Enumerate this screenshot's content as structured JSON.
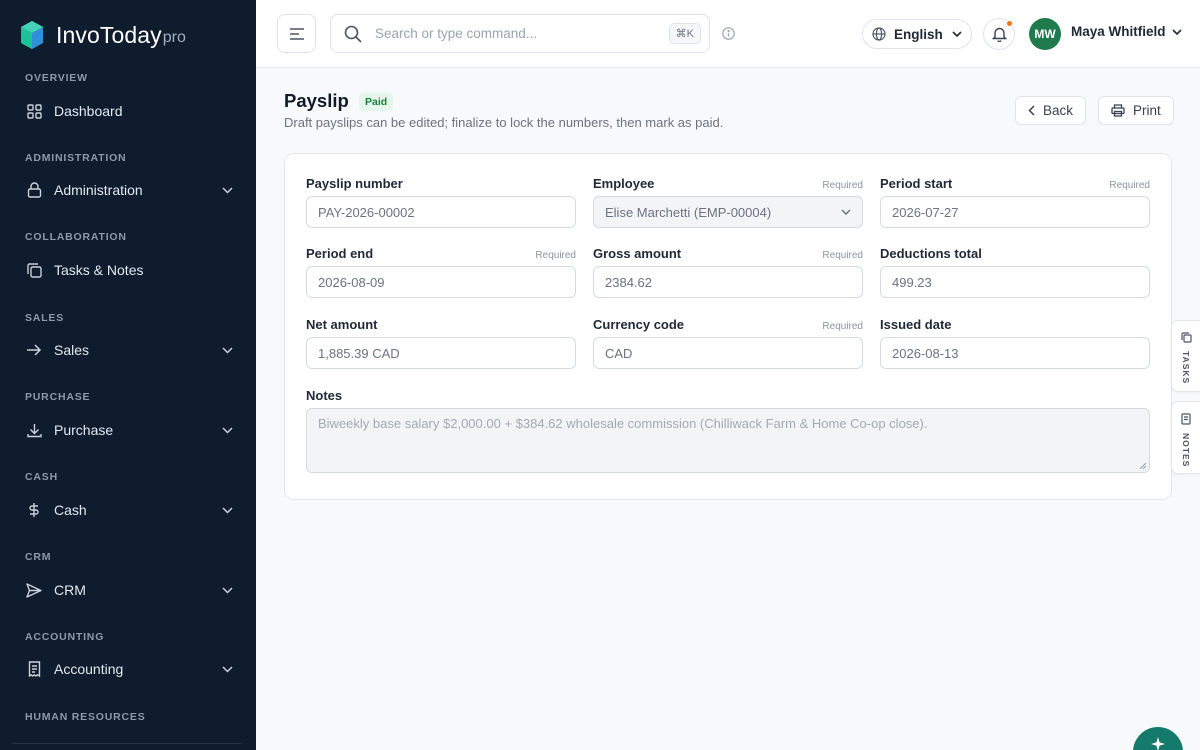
{
  "brand": {
    "name": "InvoToday",
    "suffix": "pro"
  },
  "sidebar": {
    "sections": [
      {
        "label": "OVERVIEW",
        "item": "Dashboard",
        "icon": "grid-icon",
        "expandable": false
      },
      {
        "label": "ADMINISTRATION",
        "item": "Administration",
        "icon": "lock-icon",
        "expandable": true
      },
      {
        "label": "COLLABORATION",
        "item": "Tasks & Notes",
        "icon": "copy-icon",
        "expandable": false
      },
      {
        "label": "SALES",
        "item": "Sales",
        "icon": "arrow-right-icon",
        "expandable": true
      },
      {
        "label": "PURCHASE",
        "item": "Purchase",
        "icon": "download-icon",
        "expandable": true
      },
      {
        "label": "CASH",
        "item": "Cash",
        "icon": "dollar-icon",
        "expandable": true
      },
      {
        "label": "CRM",
        "item": "CRM",
        "icon": "send-icon",
        "expandable": true
      },
      {
        "label": "ACCOUNTING",
        "item": "Accounting",
        "icon": "receipt-icon",
        "expandable": true
      },
      {
        "label": "HUMAN RESOURCES"
      }
    ]
  },
  "topbar": {
    "search_placeholder": "Search or type command...",
    "shortcut": "⌘K",
    "language": "English",
    "user_initials": "MW",
    "user_name": "Maya Whitfield",
    "notification_dot_color": "#f97316",
    "avatar_color": "#1f7a4d"
  },
  "page": {
    "title": "Payslip",
    "status": "Paid",
    "subtitle": "Draft payslips can be edited; finalize to lock the numbers, then mark as paid.",
    "back_label": "Back",
    "print_label": "Print"
  },
  "form": {
    "required_text": "Required",
    "fields": [
      {
        "label": "Payslip number",
        "value": "PAY-2026-00002",
        "required": false
      },
      {
        "label": "Employee",
        "value": "Elise Marchetti (EMP-00004)",
        "required": true
      },
      {
        "label": "Period start",
        "value": "2026-07-27",
        "required": true
      },
      {
        "label": "Period end",
        "value": "2026-08-09",
        "required": true
      },
      {
        "label": "Gross amount",
        "value": "2384.62",
        "required": true
      },
      {
        "label": "Deductions total",
        "value": "499.23",
        "required": false
      },
      {
        "label": "Net amount",
        "value": "1,885.39 CAD",
        "required": false
      },
      {
        "label": "Currency code",
        "value": "CAD",
        "required": true
      },
      {
        "label": "Issued date",
        "value": "2026-08-13",
        "required": false
      }
    ],
    "notes_label": "Notes",
    "notes_value": "Biweekly base salary $2,000.00 + $384.62 wholesale commission (Chilliwack Farm & Home Co-op close)."
  },
  "side_tabs": {
    "tasks": "TASKS",
    "notes": "NOTES"
  },
  "colors": {
    "sidebar_bg": "#0f1c2e",
    "accent": "#147a6c",
    "paid_badge": "#15803d"
  }
}
